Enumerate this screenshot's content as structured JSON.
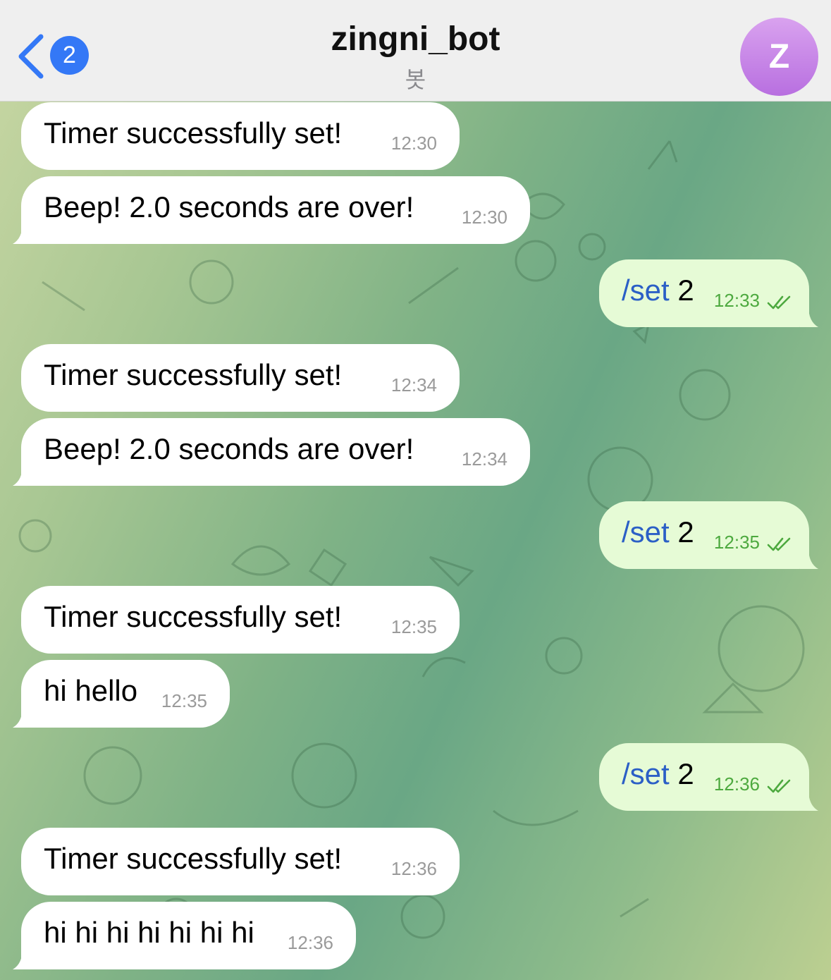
{
  "header": {
    "back_badge": "2",
    "title": "zingni_bot",
    "subtitle": "봇",
    "avatar_letter": "Z",
    "avatar_color": "#c98ae8"
  },
  "colors": {
    "incoming": "#ffffff",
    "outgoing": "#e6fbd6",
    "link": "#2b5fc6",
    "read_check": "#4da93f"
  },
  "messages": [
    {
      "dir": "in",
      "text": "Timer successfully set!",
      "time": "12:30"
    },
    {
      "dir": "in",
      "text": "Beep! 2.0 seconds are over!",
      "time": "12:30"
    },
    {
      "dir": "out",
      "command": "/set",
      "text": " 2",
      "time": "12:33",
      "status": "read"
    },
    {
      "dir": "in",
      "text": "Timer successfully set!",
      "time": "12:34"
    },
    {
      "dir": "in",
      "text": "Beep! 2.0 seconds are over!",
      "time": "12:34"
    },
    {
      "dir": "out",
      "command": "/set",
      "text": " 2",
      "time": "12:35",
      "status": "read"
    },
    {
      "dir": "in",
      "text": "Timer successfully set!",
      "time": "12:35"
    },
    {
      "dir": "in",
      "text": "hi hello",
      "time": "12:35"
    },
    {
      "dir": "out",
      "command": "/set",
      "text": " 2",
      "time": "12:36",
      "status": "read"
    },
    {
      "dir": "in",
      "text": "Timer successfully set!",
      "time": "12:36"
    },
    {
      "dir": "in",
      "text": "hi hi hi hi hi hi hi",
      "time": "12:36"
    }
  ]
}
